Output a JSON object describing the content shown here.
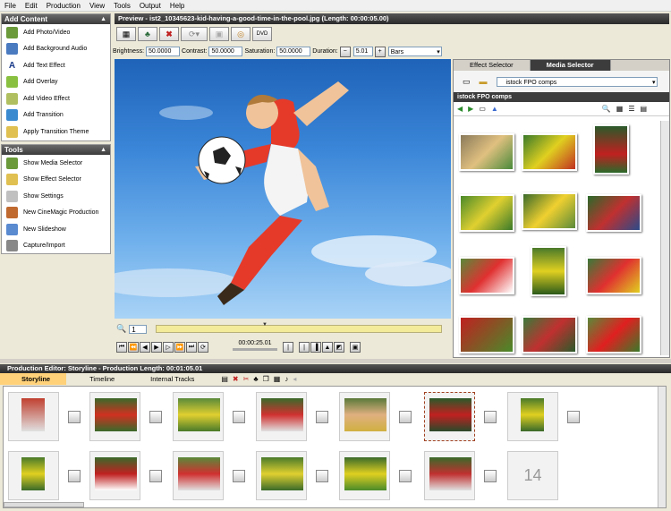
{
  "menu": [
    "File",
    "Edit",
    "Production",
    "View",
    "Tools",
    "Output",
    "Help"
  ],
  "add_content": {
    "title": "Add Content",
    "items": [
      "Add Photo/Video",
      "Add Background Audio",
      "Add Text Effect",
      "Add Overlay",
      "Add Video Effect",
      "Add Transition",
      "Apply Transition Theme"
    ]
  },
  "tools": {
    "title": "Tools",
    "items": [
      "Show Media Selector",
      "Show Effect Selector",
      "Show Settings",
      "New CineMagic Production",
      "New Slideshow",
      "Capture/Import"
    ]
  },
  "preview": {
    "title": "Preview - ist2_10345623-kid-having-a-good-time-in-the-pool.jpg (Length: 00:00:05.00)"
  },
  "adjust": {
    "brightness_label": "Brightness:",
    "brightness": "50.0000",
    "contrast_label": "Contrast:",
    "contrast": "50.0000",
    "saturation_label": "Saturation:",
    "saturation": "50.0000",
    "duration_label": "Duration:",
    "duration": "5.01",
    "style": "Bars"
  },
  "right_panel": {
    "tabs": [
      "Effect Selector",
      "Media Selector"
    ],
    "active_tab": "Media Selector",
    "folder": "istock FPO comps",
    "section": "istock FPO comps"
  },
  "transport": {
    "frame": "1",
    "time": "00:00:25.01"
  },
  "editor": {
    "title": "Production Editor: Storyline - Production Length: 00:01:05.01",
    "tabs": [
      "Storyline",
      "Timeline",
      "Internal Tracks"
    ],
    "placeholder_number": "14"
  },
  "colors": {
    "accent": "#ffd27a",
    "header_dark": "#3c3c3c"
  }
}
